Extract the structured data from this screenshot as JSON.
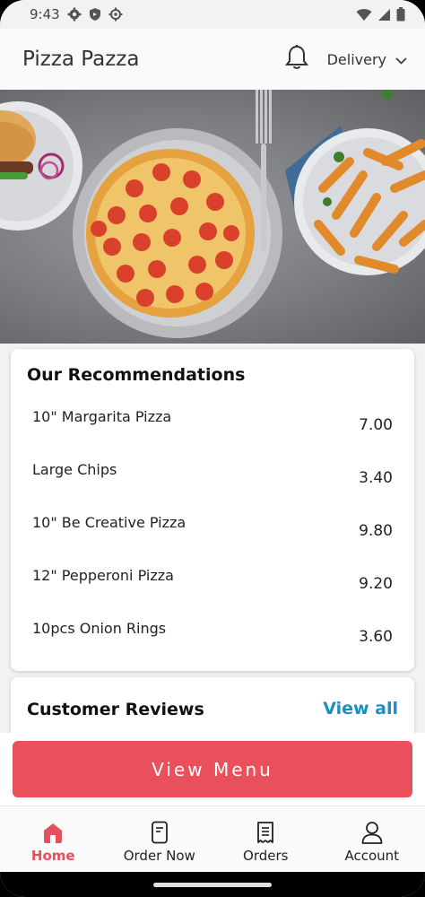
{
  "status_bar": {
    "time": "9:43",
    "icons": [
      "gear-icon",
      "shield-icon",
      "settings-cog-icon",
      "wifi-icon",
      "signal-icon",
      "battery-icon"
    ]
  },
  "header": {
    "title": "Pizza Pazza",
    "delivery_label": "Delivery"
  },
  "recommendations": {
    "title": "Our Recommendations",
    "items": [
      {
        "name": "10\" Margarita Pizza",
        "price": "7.00"
      },
      {
        "name": "Large Chips",
        "price": "3.40"
      },
      {
        "name": "10\" Be Creative Pizza",
        "price": "9.80"
      },
      {
        "name": "12\" Pepperoni Pizza",
        "price": "9.20"
      },
      {
        "name": "10pcs Onion Rings",
        "price": "3.60"
      }
    ]
  },
  "reviews": {
    "title": "Customer Reviews",
    "view_all": "View all"
  },
  "cta": {
    "view_menu": "View Menu"
  },
  "tabs": [
    {
      "label": "Home",
      "icon": "home-icon",
      "active": true
    },
    {
      "label": "Order Now",
      "icon": "order-icon",
      "active": false
    },
    {
      "label": "Orders",
      "icon": "receipt-icon",
      "active": false
    },
    {
      "label": "Account",
      "icon": "person-icon",
      "active": false
    }
  ],
  "colors": {
    "accent": "#ea4f5c",
    "link": "#1a8fc1",
    "active_tab": "#e5505d"
  }
}
